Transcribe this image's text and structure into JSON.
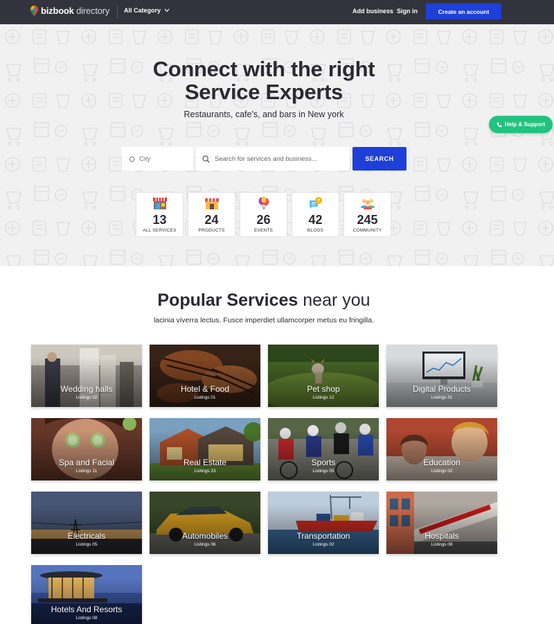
{
  "header": {
    "logo_bold": "bizbook",
    "logo_light": "directory",
    "category_label": "All Category",
    "add_business": "Add business",
    "sign_in": "Sign in",
    "create_account": "Create an account"
  },
  "hero": {
    "title_line1": "Connect with the right",
    "title_line2": "Service Experts",
    "subtitle": "Restaurants, cafe's, and bars in New york",
    "help_label": "Help & Support",
    "city_placeholder": "City",
    "search_placeholder": "Search for services and business...",
    "search_button": "SEARCH"
  },
  "stats": [
    {
      "icon": "store-icon",
      "value": "13",
      "label": "ALL SERVICES"
    },
    {
      "icon": "shop-icon",
      "value": "24",
      "label": "PRODUCTS"
    },
    {
      "icon": "balloons-icon",
      "value": "26",
      "label": "EVENTS"
    },
    {
      "icon": "chat-bubbles-icon",
      "value": "42",
      "label": "BLOGS"
    },
    {
      "icon": "community-icon",
      "value": "245",
      "label": "COMMUNITY"
    }
  ],
  "popular": {
    "title_bold": "Popular Services",
    "title_light": "near you",
    "subtitle": "lacinia viverra lectus. Fusce imperdiet ullamcorper metus eu fringilla."
  },
  "services": [
    {
      "name": "Wedding halls",
      "count": "Listings 02"
    },
    {
      "name": "Hotel & Food",
      "count": "Listings 01"
    },
    {
      "name": "Pet shop",
      "count": "Listings 12"
    },
    {
      "name": "Digital Products",
      "count": "Listings 31"
    },
    {
      "name": "Spa and Facial",
      "count": "Listings 11"
    },
    {
      "name": "Real Estate",
      "count": "Listings 23"
    },
    {
      "name": "Sports",
      "count": "Listings 05"
    },
    {
      "name": "Education",
      "count": "Listings 02"
    },
    {
      "name": "Electricals",
      "count": "Listings 05"
    },
    {
      "name": "Automobiles",
      "count": "Listings 06"
    },
    {
      "name": "Transportation",
      "count": "Listings 02"
    },
    {
      "name": "Hospitals",
      "count": "Listings 08"
    },
    {
      "name": "Hotels And Resorts",
      "count": "Listings 08"
    }
  ],
  "colors": {
    "topbar": "#33333d",
    "primary": "#1e3fd8",
    "help": "#22c37e",
    "hero_bg": "#f1f1f2"
  }
}
